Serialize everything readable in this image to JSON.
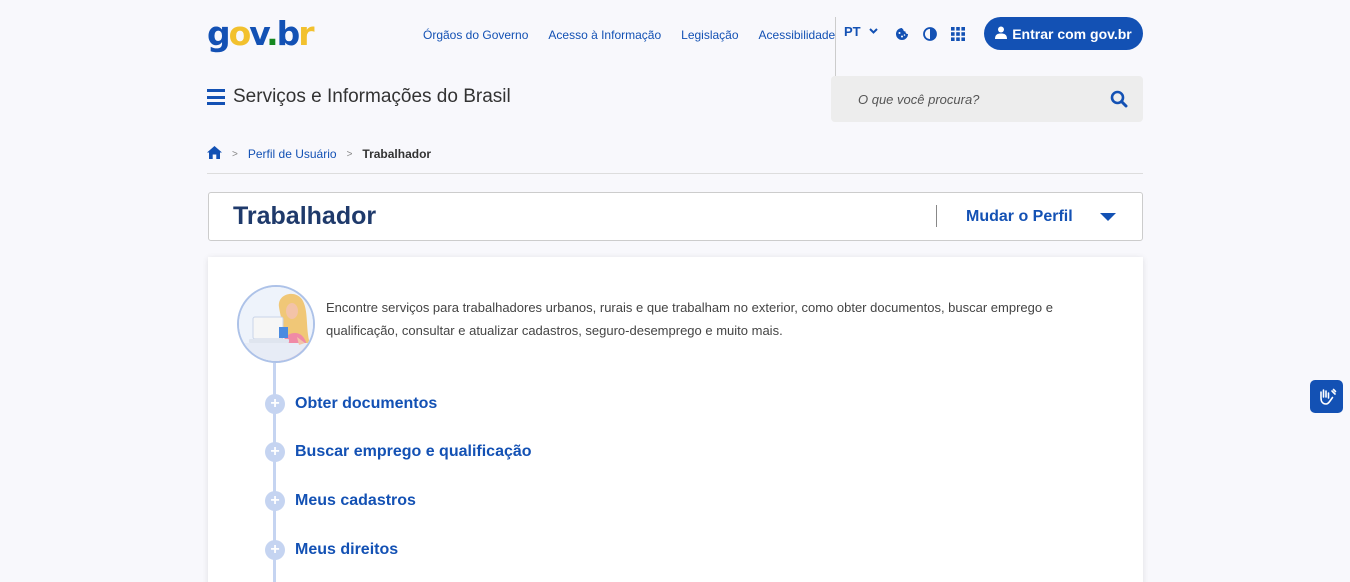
{
  "header": {
    "logo": {
      "g": "g",
      "o": "o",
      "v": "v",
      "dot": ".",
      "b": "b",
      "r": "r"
    },
    "nav_links": [
      "Órgãos do Governo",
      "Acesso à Informação",
      "Legislação",
      "Acessibilidade"
    ],
    "language": "PT",
    "icons": [
      "cookie-icon",
      "contrast-icon",
      "apps-grid-icon"
    ],
    "login_label": "Entrar com gov.br"
  },
  "site": {
    "title": "Serviços e Informações do Brasil",
    "search_placeholder": "O que você procura?"
  },
  "breadcrumb": {
    "home_icon": "home-icon",
    "items": [
      "Perfil de Usuário",
      "Trabalhador"
    ]
  },
  "profile": {
    "title": "Trabalhador",
    "change_label": "Mudar o Perfil"
  },
  "intro": {
    "text": "Encontre serviços para trabalhadores urbanos, rurais e que trabalham no exterior, como obter documentos, buscar emprego e qualificação, consultar e atualizar cadastros, seguro-desemprego e muito mais."
  },
  "categories": [
    "Obter documentos",
    "Buscar emprego e qualificação",
    "Meus cadastros",
    "Meus direitos"
  ],
  "colors": {
    "primary": "#1351b4",
    "yellow": "#f2c12e",
    "green": "#168821",
    "timeline": "#c5d4f1",
    "title_dark": "#1f3a6b"
  },
  "accessibility_widget": "vlibras-hands-icon"
}
